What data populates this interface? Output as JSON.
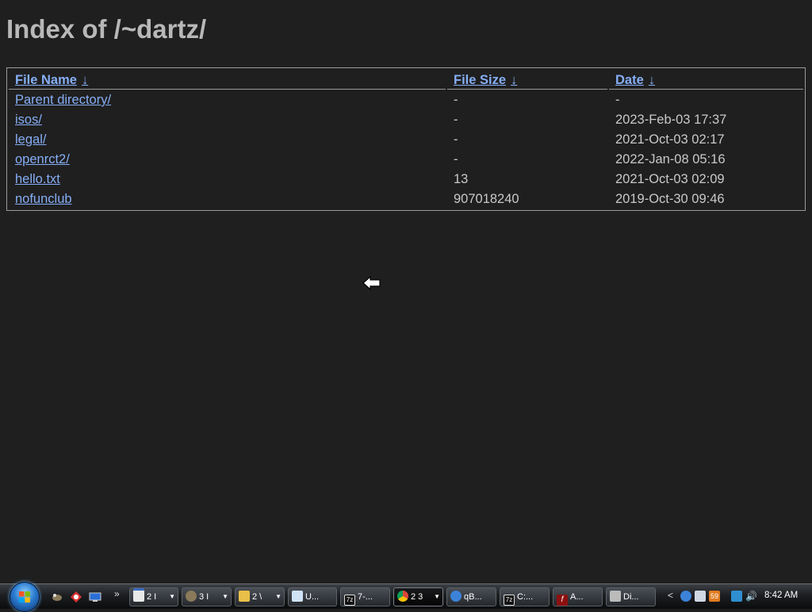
{
  "page": {
    "title": "Index of /~dartz/"
  },
  "table": {
    "headers": {
      "name": "File Name",
      "size": "File Size",
      "date": "Date",
      "sort_arrow": "↓"
    },
    "rows": [
      {
        "name": "Parent directory/",
        "size": "-",
        "date": "-"
      },
      {
        "name": "isos/",
        "size": "-",
        "date": "2023-Feb-03 17:37"
      },
      {
        "name": "legal/",
        "size": "-",
        "date": "2021-Oct-03 02:17"
      },
      {
        "name": "openrct2/",
        "size": "-",
        "date": "2022-Jan-08 05:16"
      },
      {
        "name": "hello.txt",
        "size": "13",
        "date": "2021-Oct-03 02:09"
      },
      {
        "name": "nofunclub",
        "size": "907018240",
        "date": "2019-Oct-30 09:46"
      }
    ]
  },
  "taskbar": {
    "buttons": [
      {
        "label": "2 I",
        "icon": "window-icon"
      },
      {
        "label": "3 I",
        "icon": "gimp-icon"
      },
      {
        "label": "2 \\",
        "icon": "folder-icon"
      },
      {
        "label": "U...",
        "icon": "notepad-icon"
      },
      {
        "label": "7-...",
        "icon": "7zip-icon"
      },
      {
        "label": "2 3",
        "icon": "chrome-icon"
      },
      {
        "label": "qB...",
        "icon": "qbittorrent-icon"
      },
      {
        "label": "C:...",
        "icon": "7zip-icon"
      },
      {
        "label": "A...",
        "icon": "flash-icon"
      },
      {
        "label": "Di...",
        "icon": "disk-icon"
      }
    ],
    "tray": {
      "badge": "59",
      "clock": "8:42 AM"
    },
    "overflow": "»",
    "tray_expand": "<"
  },
  "colors": {
    "background": "#1f1f1f",
    "link": "#86aef5",
    "text": "#c9c9c9",
    "title": "#b8b8b8"
  }
}
